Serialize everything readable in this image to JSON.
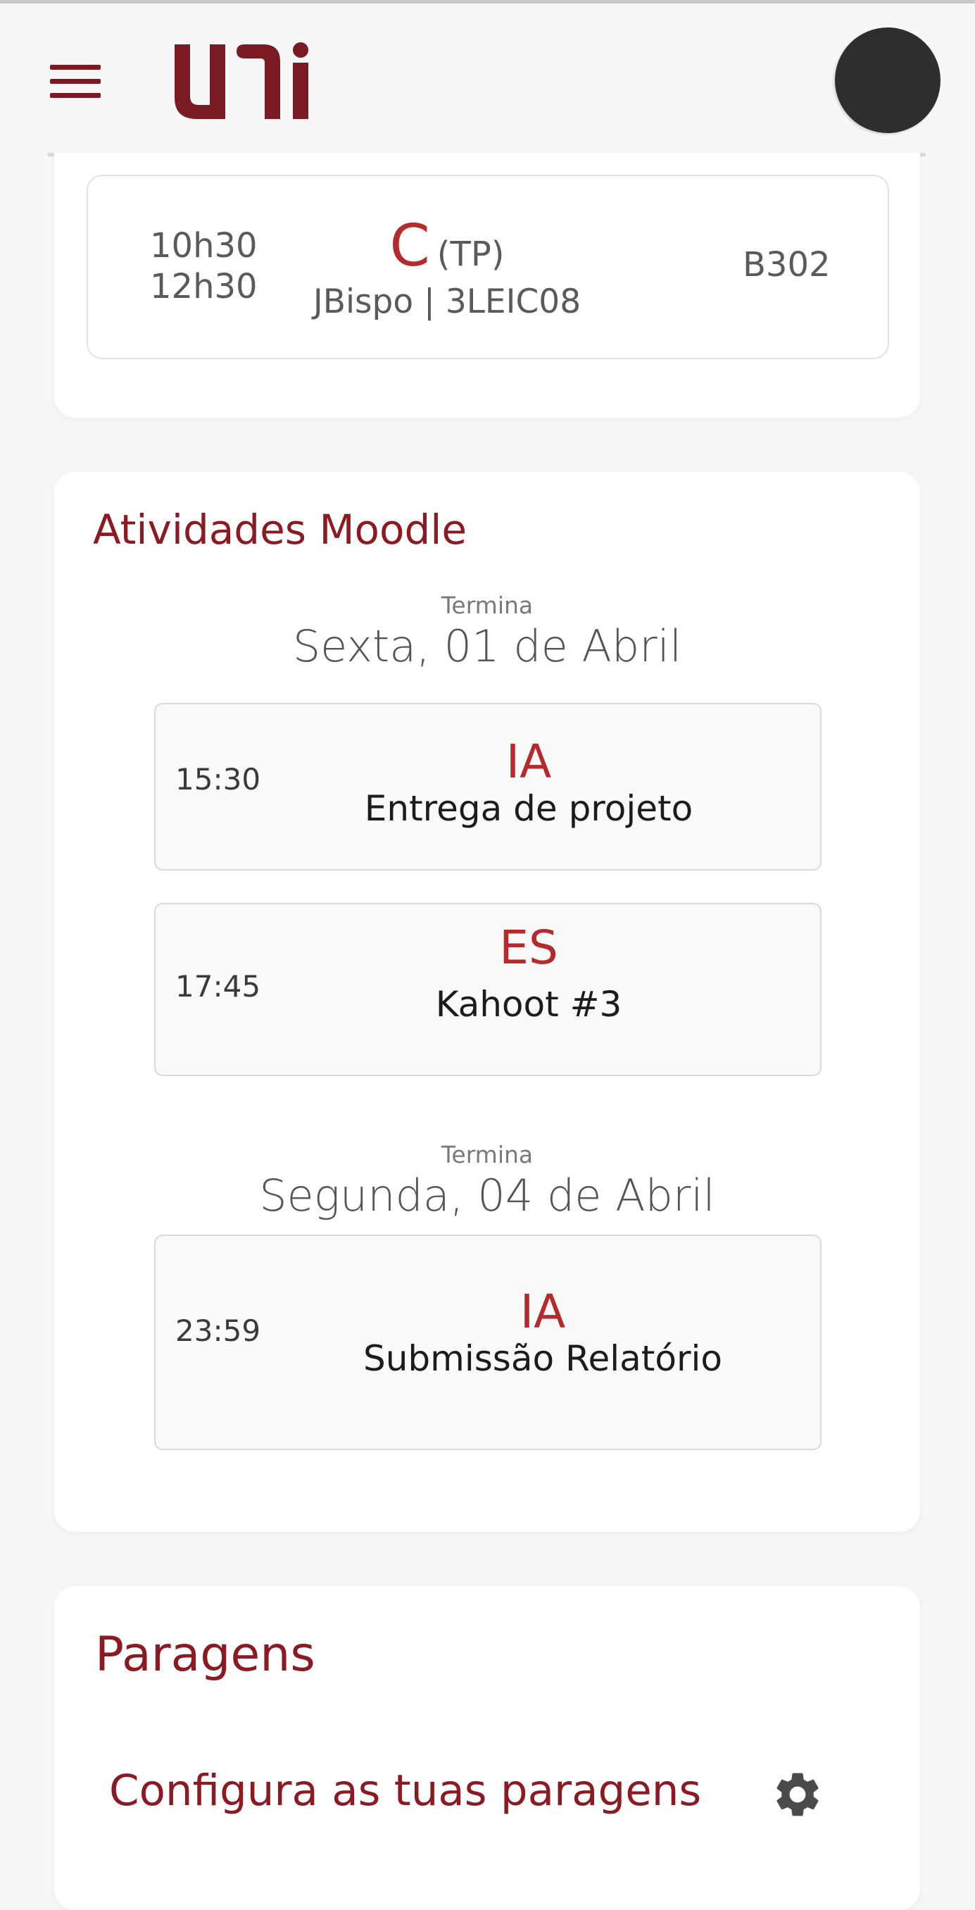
{
  "header": {
    "logo_text": "uni",
    "menu_icon": "hamburger-menu-icon",
    "avatar_icon": "user-avatar"
  },
  "lecture": {
    "start_time": "10h30",
    "end_time": "12h30",
    "subject": "C",
    "type": "(TP)",
    "teacher_class": "JBispo | 3LEIC08",
    "room": "B302"
  },
  "moodle": {
    "title": "Atividades Moodle",
    "days": [
      {
        "ends_label": "Termina",
        "date": "Sexta, 01 de Abril",
        "activities": [
          {
            "time": "15:30",
            "uc": "IA",
            "name": "Entrega de projeto"
          },
          {
            "time": "17:45",
            "uc": "ES",
            "name": "Kahoot #3"
          }
        ]
      },
      {
        "ends_label": "Termina",
        "date": "Segunda, 04 de Abril",
        "activities": [
          {
            "time": "23:59",
            "uc": "IA",
            "name": "Submissão Relatório"
          }
        ]
      }
    ]
  },
  "stops": {
    "title": "Paragens",
    "config_label": "Configura as tuas paragens",
    "config_icon": "gear-icon"
  },
  "colors": {
    "brand": "#8b1a22",
    "accent_red": "#b52a2a",
    "background": "#f7f7f7",
    "avatar": "#2e2e2e"
  }
}
